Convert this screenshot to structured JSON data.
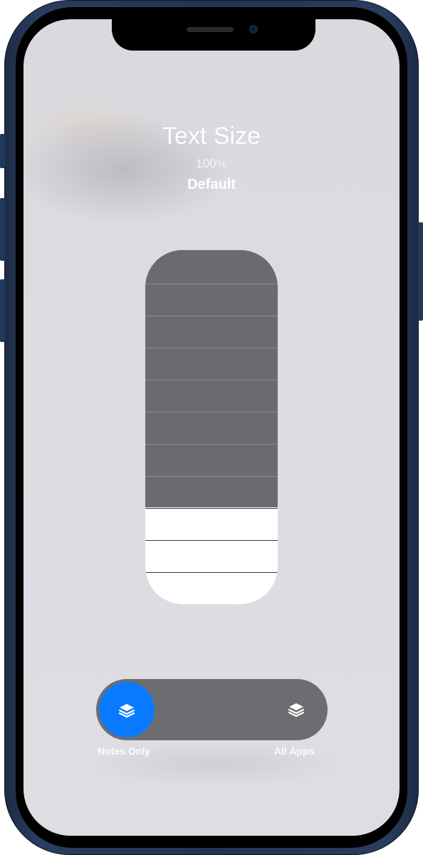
{
  "text_size": {
    "title": "Text Size",
    "percent": "100%",
    "preset": "Default",
    "slider_steps": 10,
    "slider_level": 3
  },
  "scope_toggle": {
    "options": [
      {
        "label": "Notes Only",
        "icon": "layers-icon",
        "selected": true
      },
      {
        "label": "All Apps",
        "icon": "layers-icon",
        "selected": false
      }
    ]
  },
  "colors": {
    "accent": "#0a7aff",
    "slider_track": "#6b6b6f",
    "slider_fill": "#ffffff",
    "toggle_track": "#6d6d71"
  }
}
